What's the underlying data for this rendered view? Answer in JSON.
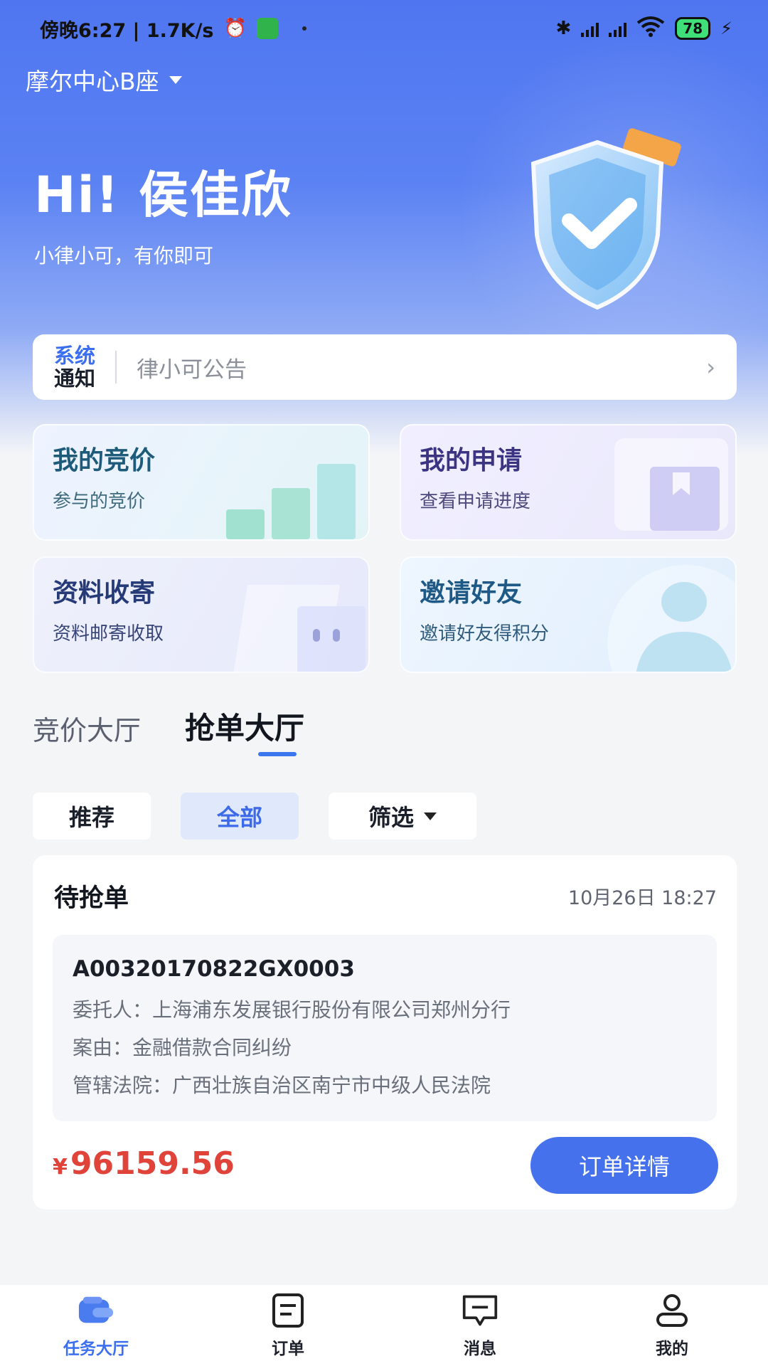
{
  "status_bar": {
    "left_text": "傍晚6:27 | 1.7K/s",
    "battery": "78"
  },
  "header": {
    "location": "摩尔中心B座",
    "greeting": "Hi!  侯佳欣",
    "slogan": "小律小可，有你即可"
  },
  "notice": {
    "tag_line1": "系统",
    "tag_line2": "通知",
    "text": "律小可公告",
    "chevron": "›"
  },
  "quick_cards": [
    {
      "title": "我的竞价",
      "subtitle": "参与的竞价"
    },
    {
      "title": "我的申请",
      "subtitle": "查看申请进度"
    },
    {
      "title": "资料收寄",
      "subtitle": "资料邮寄收取"
    },
    {
      "title": "邀请好友",
      "subtitle": "邀请好友得积分"
    }
  ],
  "tabs": [
    {
      "label": "竞价大厅",
      "active": false
    },
    {
      "label": "抢单大厅",
      "active": true
    }
  ],
  "filters": {
    "recommend": "推荐",
    "all": "全部",
    "filter": "筛选"
  },
  "order": {
    "status": "待抢单",
    "time": "10月26日 18:27",
    "number": "A00320170822GX0003",
    "client": "委托人：上海浦东发展银行股份有限公司郑州分行",
    "cause": "案由：金融借款合同纠纷",
    "court": "管辖法院：广西壮族自治区南宁市中级人民法院",
    "currency": "¥",
    "price": "96159.56",
    "detail_button": "订单详情"
  },
  "bottom_nav": [
    {
      "label": "任务大厅",
      "icon": "task-hall-icon",
      "active": true
    },
    {
      "label": "订单",
      "icon": "order-icon",
      "active": false
    },
    {
      "label": "消息",
      "icon": "message-icon",
      "active": false
    },
    {
      "label": "我的",
      "icon": "profile-icon",
      "active": false
    }
  ],
  "colors": {
    "primary": "#3c6ff0",
    "price": "#e0433a",
    "header_gradient_top": "#4f76f0"
  }
}
